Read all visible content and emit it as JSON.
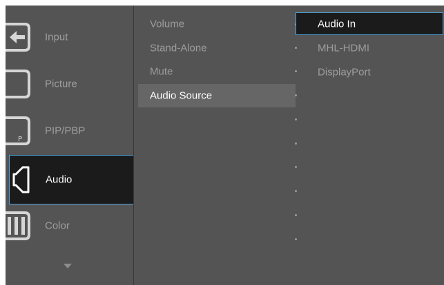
{
  "main_menu": {
    "items": [
      {
        "label": "Input",
        "icon": "input-icon"
      },
      {
        "label": "Picture",
        "icon": "picture-icon"
      },
      {
        "label": "PIP/PBP",
        "icon": "pip-pbp-icon",
        "icon_text": "P"
      },
      {
        "label": "Audio",
        "icon": "audio-icon",
        "active": true
      },
      {
        "label": "Color",
        "icon": "color-icon"
      }
    ],
    "more_icon": "chevron-down-icon"
  },
  "submenu": {
    "items": [
      {
        "label": "Volume"
      },
      {
        "label": "Stand-Alone"
      },
      {
        "label": "Mute"
      },
      {
        "label": "Audio Source",
        "selected": true
      }
    ]
  },
  "options": {
    "items": [
      {
        "label": "Audio In",
        "active": true
      },
      {
        "label": "MHL-HDMI"
      },
      {
        "label": "DisplayPort"
      }
    ]
  },
  "colors": {
    "panel_bg": "#545454",
    "active_bg": "#1b1b1b",
    "active_border": "#4fa7e0",
    "selected_bg": "#666666",
    "text_dim": "#9d9d9d",
    "text_active": "#ffffff"
  }
}
